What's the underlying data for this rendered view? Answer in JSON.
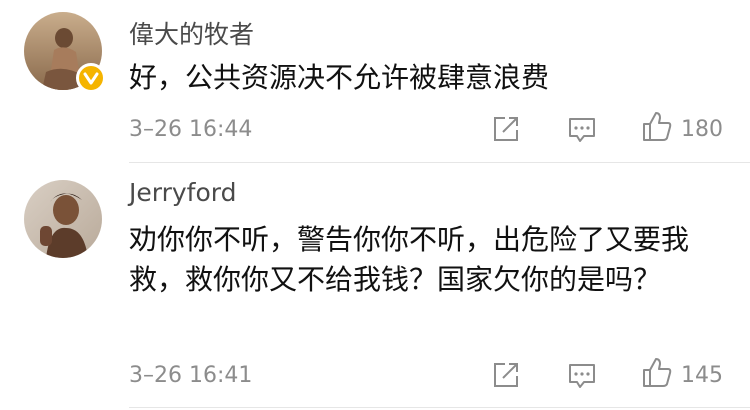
{
  "comments": [
    {
      "avatar_icon": "user-avatar-photo",
      "verified_icon": "verified-badge-icon",
      "username": "偉大的牧者",
      "text": "好，公共资源决不允许被肆意浪费",
      "time": "3–26 16:44",
      "likes": "180"
    },
    {
      "avatar_icon": "user-avatar-photo",
      "username": "Jerryford",
      "text": "劝你你不听，警告你你不听，出危险了又要我救，救你你又不给我钱？国家欠你的是吗？",
      "time": "3–26 16:41",
      "likes": "145"
    }
  ],
  "colors": {
    "username": "#4a4a4a",
    "text": "#111111",
    "meta": "#8c8c8c",
    "verified": "#f5b400",
    "divider": "#e6e6e6"
  }
}
